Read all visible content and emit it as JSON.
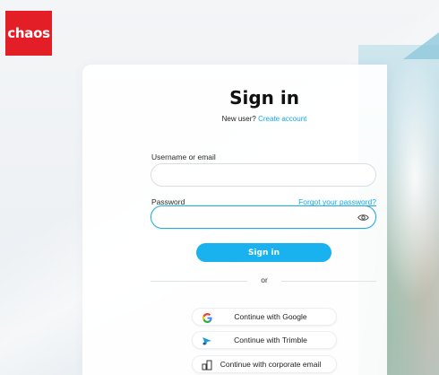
{
  "brand": {
    "logo_text": "chaos",
    "color": "#e41e26"
  },
  "page": {
    "title": "Sign in",
    "new_user_prompt": "New user?",
    "create_account_link": "Create account"
  },
  "form": {
    "username_label": "Username or email",
    "username_value": "",
    "password_label": "Password",
    "password_value": "",
    "forgot_password_link": "Forgot your password?",
    "show_password_icon": "eye-icon",
    "submit_label": "Sign in"
  },
  "divider_text": "or",
  "social_buttons": [
    {
      "label": "Continue with Google",
      "icon": "google-icon"
    },
    {
      "label": "Continue with Trimble",
      "icon": "trimble-icon"
    },
    {
      "label": "Continue with corporate email",
      "icon": "building-icon"
    }
  ],
  "colors": {
    "accent": "#19b2ee",
    "link": "#17a6e6",
    "input_focus": "#29a9dc"
  }
}
